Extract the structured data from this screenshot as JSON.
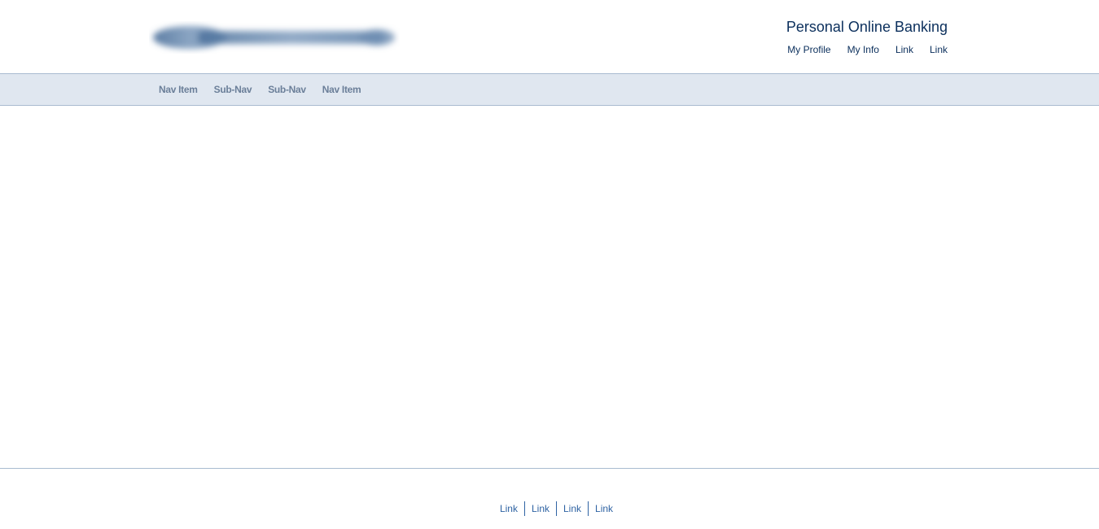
{
  "header": {
    "title": "Personal Online Banking",
    "util_links": [
      "My Profile",
      "My Info",
      "Link",
      "Link"
    ]
  },
  "nav": {
    "items": [
      "Nav Item",
      "Sub-Nav",
      "Sub-Nav",
      "Nav Item"
    ]
  },
  "footer": {
    "links": [
      "Link",
      "Link",
      "Link",
      "Link"
    ]
  },
  "colors": {
    "brand_dark": "#0b2f5c",
    "nav_bg": "#e0e7f0",
    "nav_text": "#6b7f99",
    "border": "#a9bbd0",
    "footer_link": "#2f63a3"
  }
}
